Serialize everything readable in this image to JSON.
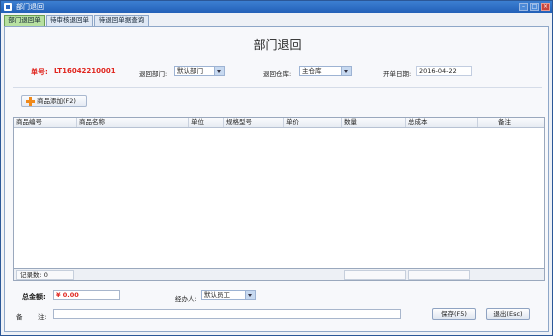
{
  "window": {
    "title": "部门退回"
  },
  "tabs": [
    {
      "label": "部门退回单"
    },
    {
      "label": "待审核退回单"
    },
    {
      "label": "待退回单据查询"
    }
  ],
  "page": {
    "title": "部门退回"
  },
  "form": {
    "order_no_label": "单号:",
    "order_no_value": "LT16042210001",
    "return_dept_label": "退回部门:",
    "return_dept_value": "默认部门",
    "return_warehouse_label": "退回仓库:",
    "return_warehouse_value": "主仓库",
    "date_label": "开单日期:",
    "date_value": "2016-04-22"
  },
  "toolbar": {
    "add_product_label": "商品添加(F2)"
  },
  "grid": {
    "columns": [
      "商品编号",
      "商品名称",
      "单位",
      "规格型号",
      "单价",
      "数量",
      "总成本",
      "备注"
    ]
  },
  "status": {
    "record_count_label": "记录数: 0"
  },
  "footer": {
    "total_label": "总金额:",
    "total_value": "¥ 0.00",
    "handler_label": "经办人:",
    "handler_value": "默认员工",
    "remark_label_1": "备",
    "remark_label_2": "注:",
    "save_label": "保存(F5)",
    "exit_label": "退出(Esc)"
  },
  "colors": {
    "accent": "#e0231c",
    "active_tab": "#b7e0a0",
    "titlebar": "#2a66c0"
  }
}
